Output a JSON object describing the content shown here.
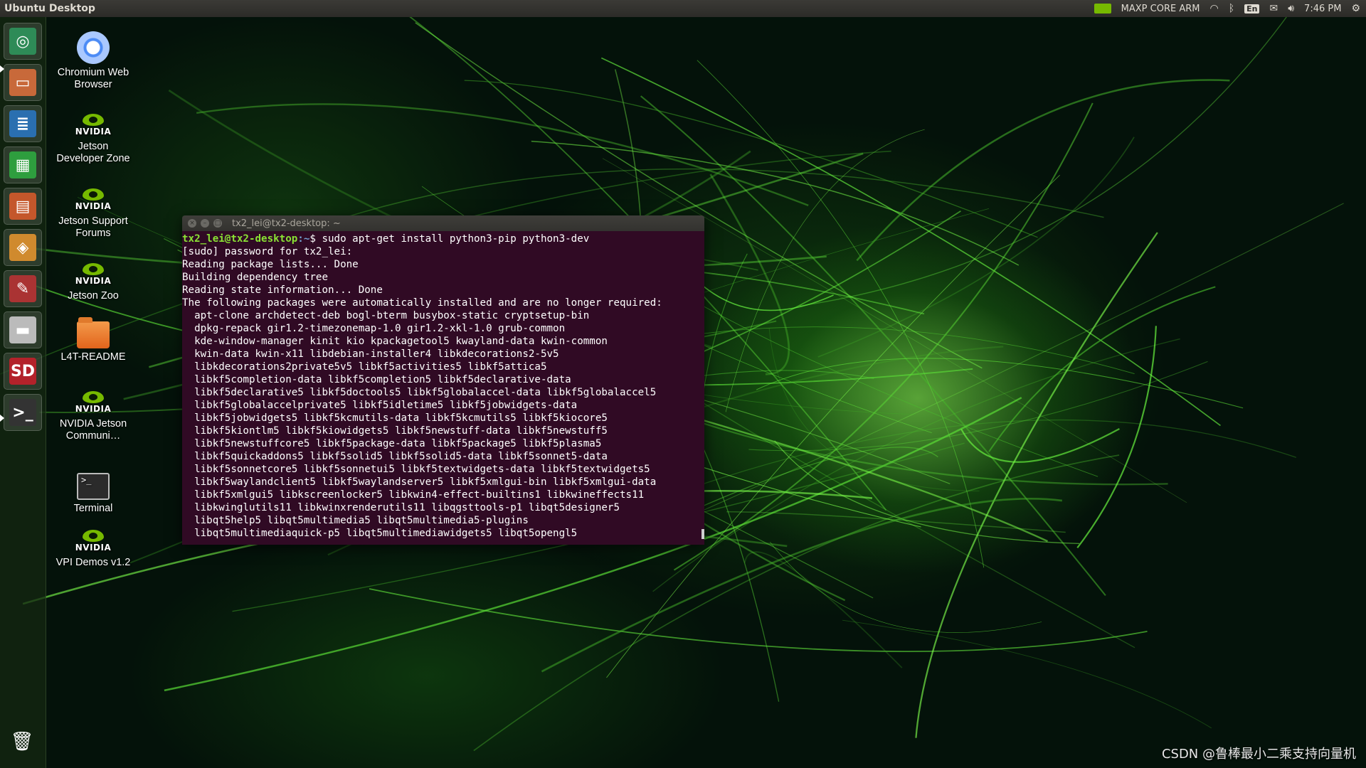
{
  "topbar": {
    "title": "Ubuntu Desktop",
    "power_mode": "MAXP CORE ARM",
    "keyboard": "En",
    "clock": "7:46 PM",
    "icons": [
      "nvidia-icon",
      "wifi-icon",
      "bluetooth-icon",
      "mail-icon",
      "volume-icon",
      "gear-icon"
    ]
  },
  "launcher": {
    "items": [
      {
        "name": "ubuntu-dash",
        "glyph": "◎",
        "color": "#2e8b57"
      },
      {
        "name": "files",
        "glyph": "▭",
        "color": "#c8693a"
      },
      {
        "name": "libreoffice-writer",
        "glyph": "≣",
        "color": "#2a6fb0"
      },
      {
        "name": "libreoffice-calc",
        "glyph": "▦",
        "color": "#2e9e3e"
      },
      {
        "name": "libreoffice-impress",
        "glyph": "▤",
        "color": "#c4572b"
      },
      {
        "name": "software-center",
        "glyph": "◈",
        "color": "#d08a2e"
      },
      {
        "name": "system-settings",
        "glyph": "✎",
        "color": "#a33"
      },
      {
        "name": "drive",
        "glyph": "▬",
        "color": "#bbb"
      },
      {
        "name": "sd-card",
        "glyph": "SD",
        "color": "#b3222a"
      },
      {
        "name": "terminal",
        "glyph": ">_",
        "color": "#333"
      }
    ],
    "trash_glyph": "🗑"
  },
  "desktop_icons": [
    {
      "type": "chrome",
      "label": "Chromium Web Browser"
    },
    {
      "type": "nvidia",
      "label": "Jetson Developer Zone"
    },
    {
      "type": "nvidia",
      "label": "Jetson Support Forums"
    },
    {
      "type": "nvidia",
      "label": "Jetson Zoo"
    },
    {
      "type": "folder",
      "label": "L4T-README"
    },
    {
      "type": "nvidia",
      "label": "NVIDIA Jetson Communi…"
    },
    {
      "type": "terminal",
      "label": "Terminal"
    },
    {
      "type": "nvidia",
      "label": "VPI Demos v1.2"
    }
  ],
  "nvidia_word": "NVIDIA",
  "terminal_window": {
    "title": "tx2_lei@tx2-desktop: ~",
    "prompt_user": "tx2_lei@tx2-desktop",
    "prompt_path": ":~",
    "prompt_sym": "$",
    "command": " sudo apt-get install python3-pip python3-dev",
    "output": [
      "[sudo] password for tx2_lei:",
      "Reading package lists... Done",
      "Building dependency tree",
      "Reading state information... Done",
      "The following packages were automatically installed and are no longer required:",
      "  apt-clone archdetect-deb bogl-bterm busybox-static cryptsetup-bin",
      "  dpkg-repack gir1.2-timezonemap-1.0 gir1.2-xkl-1.0 grub-common",
      "  kde-window-manager kinit kio kpackagetool5 kwayland-data kwin-common",
      "  kwin-data kwin-x11 libdebian-installer4 libkdecorations2-5v5",
      "  libkdecorations2private5v5 libkf5activities5 libkf5attica5",
      "  libkf5completion-data libkf5completion5 libkf5declarative-data",
      "  libkf5declarative5 libkf5doctools5 libkf5globalaccel-data libkf5globalaccel5",
      "  libkf5globalaccelprivate5 libkf5idletime5 libkf5jobwidgets-data",
      "  libkf5jobwidgets5 libkf5kcmutils-data libkf5kcmutils5 libkf5kiocore5",
      "  libkf5kiontlm5 libkf5kiowidgets5 libkf5newstuff-data libkf5newstuff5",
      "  libkf5newstuffcore5 libkf5package-data libkf5package5 libkf5plasma5",
      "  libkf5quickaddons5 libkf5solid5 libkf5solid5-data libkf5sonnet5-data",
      "  libkf5sonnetcore5 libkf5sonnetui5 libkf5textwidgets-data libkf5textwidgets5",
      "  libkf5waylandclient5 libkf5waylandserver5 libkf5xmlgui-bin libkf5xmlgui-data",
      "  libkf5xmlgui5 libkscreenlocker5 libkwin4-effect-builtins1 libkwineffects11",
      "  libkwinglutils11 libkwinxrenderutils11 libqgsttools-p1 libqt5designer5",
      "  libqt5help5 libqt5multimedia5 libqt5multimedia5-plugins",
      "  libqt5multimediaquick-p5 libqt5multimediawidgets5 libqt5opengl5"
    ]
  },
  "watermark": "CSDN @鲁棒最小二乘支持向量机"
}
